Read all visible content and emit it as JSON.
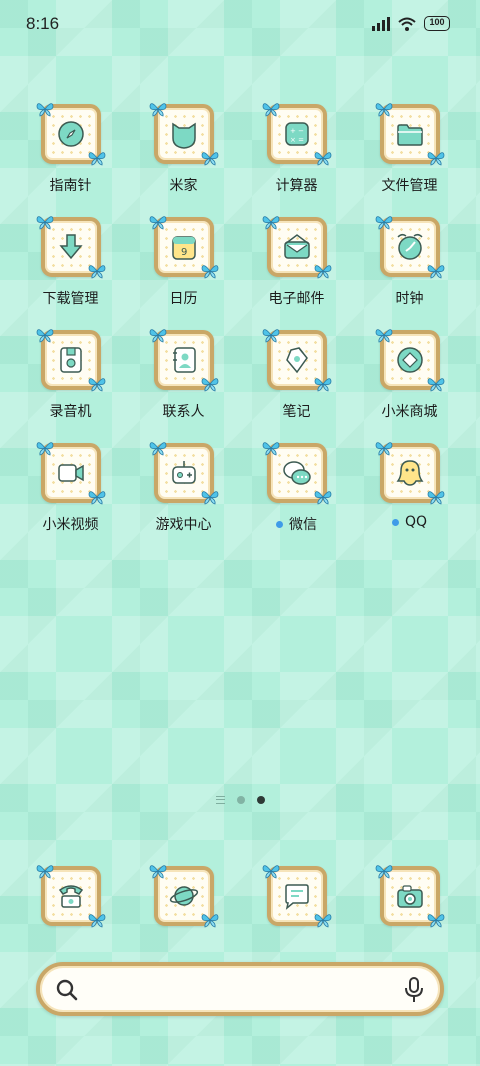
{
  "status_bar": {
    "time": "8:16",
    "battery": "100"
  },
  "apps": [
    {
      "label": "指南针",
      "icon": "compass-icon",
      "dot": false
    },
    {
      "label": "米家",
      "icon": "mijia-icon",
      "dot": false
    },
    {
      "label": "计算器",
      "icon": "calculator-icon",
      "dot": false
    },
    {
      "label": "文件管理",
      "icon": "folder-icon",
      "dot": false
    },
    {
      "label": "下载管理",
      "icon": "download-icon",
      "dot": false
    },
    {
      "label": "日历",
      "icon": "calendar-icon",
      "dot": false,
      "badge": "9"
    },
    {
      "label": "电子邮件",
      "icon": "mail-icon",
      "dot": false
    },
    {
      "label": "时钟",
      "icon": "clock-icon",
      "dot": false
    },
    {
      "label": "录音机",
      "icon": "recorder-icon",
      "dot": false
    },
    {
      "label": "联系人",
      "icon": "contacts-icon",
      "dot": false
    },
    {
      "label": "笔记",
      "icon": "notes-icon",
      "dot": false
    },
    {
      "label": "小米商城",
      "icon": "mi-store-icon",
      "dot": false
    },
    {
      "label": "小米视频",
      "icon": "video-icon",
      "dot": false
    },
    {
      "label": "游戏中心",
      "icon": "game-center-icon",
      "dot": false
    },
    {
      "label": "微信",
      "icon": "wechat-icon",
      "dot": true
    },
    {
      "label": "QQ",
      "icon": "qq-icon",
      "dot": true
    }
  ],
  "dock": [
    {
      "icon": "phone-icon"
    },
    {
      "icon": "browser-planet-icon"
    },
    {
      "icon": "messages-icon"
    },
    {
      "icon": "camera-icon"
    }
  ],
  "pager": {
    "pages": 2,
    "active": 2
  },
  "search": {
    "placeholder": ""
  },
  "colors": {
    "background": "#b3f0dc",
    "accent": "#7dd9c4",
    "frame": "#c9a767",
    "butterfly": "#4fc3e8",
    "notification_dot": "#3f9be8"
  }
}
